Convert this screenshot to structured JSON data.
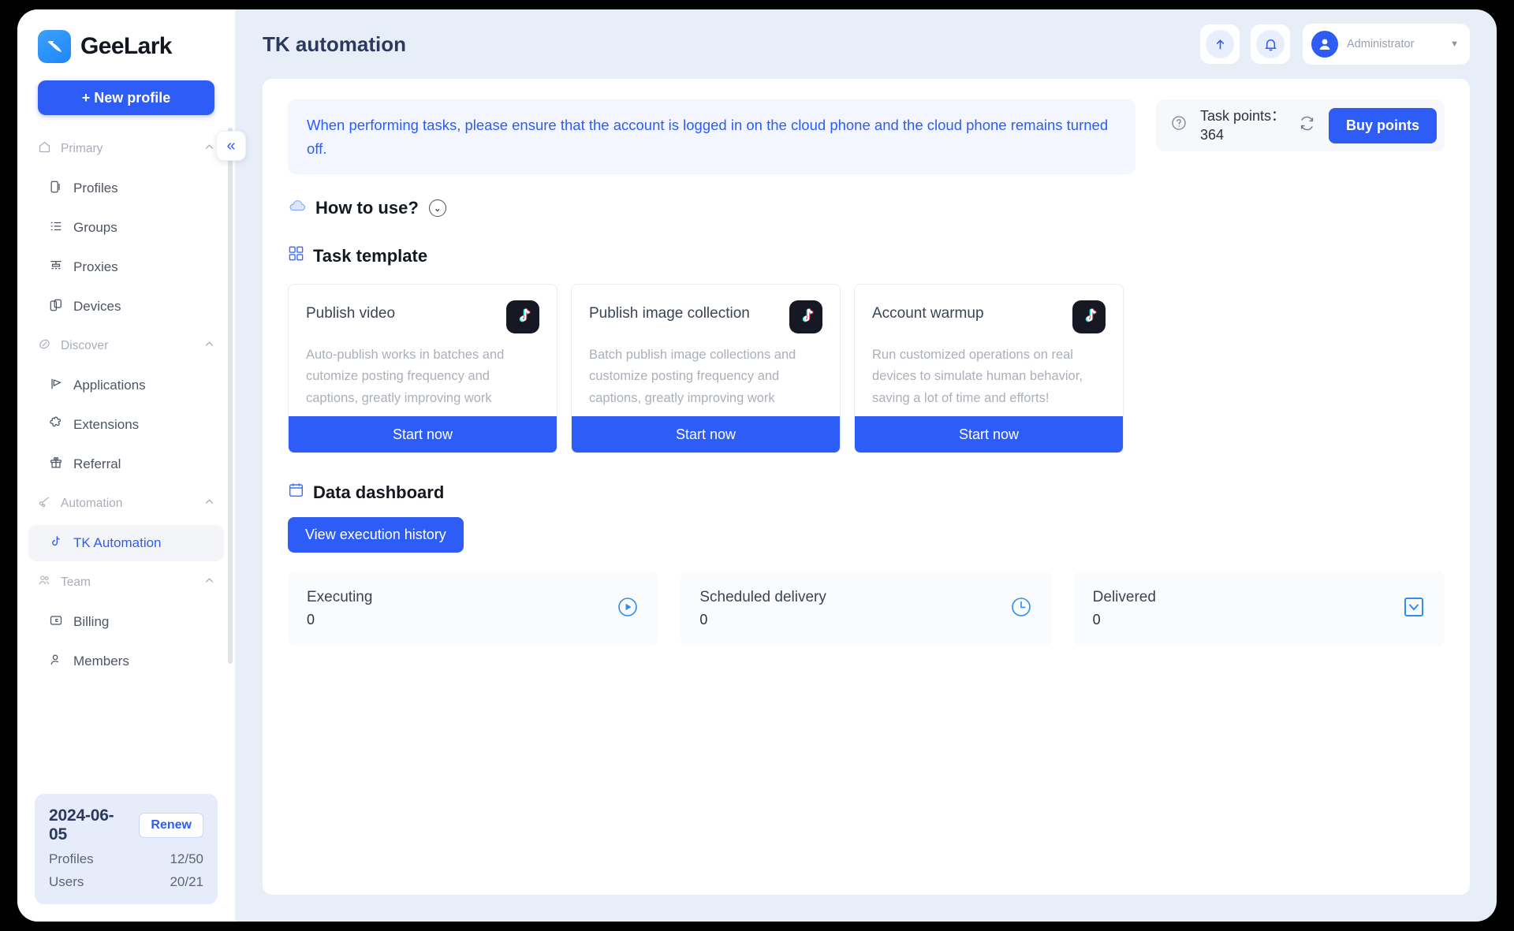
{
  "sidebar": {
    "brand": {
      "name": "GeeLark",
      "logo_icon": "geelark-bird-logo"
    },
    "new_profile_label": "+ New profile",
    "collapse_label": "«",
    "groups": [
      {
        "label": "Primary",
        "icon": "home-icon",
        "items": [
          {
            "label": "Profiles",
            "icon": "profiles-icon"
          },
          {
            "label": "Groups",
            "icon": "groups-list-icon"
          },
          {
            "label": "Proxies",
            "icon": "proxies-network-icon"
          },
          {
            "label": "Devices",
            "icon": "devices-icon"
          }
        ]
      },
      {
        "label": "Discover",
        "icon": "compass-icon",
        "items": [
          {
            "label": "Applications",
            "icon": "applications-icon"
          },
          {
            "label": "Extensions",
            "icon": "extensions-puzzle-icon"
          },
          {
            "label": "Referral",
            "icon": "gift-icon"
          }
        ]
      },
      {
        "label": "Automation",
        "icon": "automation-icon",
        "items": [
          {
            "label": "TK Automation",
            "icon": "tiktok-note-icon",
            "active": true
          }
        ]
      },
      {
        "label": "Team",
        "icon": "team-icon",
        "items": [
          {
            "label": "Billing",
            "icon": "billing-card-icon"
          },
          {
            "label": "Members",
            "icon": "member-icon"
          }
        ]
      }
    ],
    "plan": {
      "date": "2024-06-05",
      "renew_label": "Renew",
      "rows": [
        {
          "label": "Profiles",
          "value": "12/50"
        },
        {
          "label": "Users",
          "value": "20/21"
        }
      ]
    }
  },
  "header": {
    "title": "TK automation",
    "upload_icon": "upload-arrow-icon",
    "bell_icon": "bell-icon",
    "avatar_icon": "user-avatar-icon",
    "user_role": "Administrator",
    "caret_icon": "chevron-down-icon"
  },
  "notice": {
    "text": "When performing tasks, please ensure that the account is logged in on the cloud phone and the cloud phone remains turned off."
  },
  "points": {
    "help_icon": "question-circle-icon",
    "label": "Task points：",
    "value": "364",
    "refresh_icon": "refresh-icon",
    "buy_label": "Buy points"
  },
  "howto": {
    "icon": "cloud-icon",
    "label": "How to use?",
    "chevron": "⌄"
  },
  "task_template": {
    "icon": "grid-icon",
    "label": "Task template",
    "cards": [
      {
        "title": "Publish video",
        "desc": "Auto-publish works in batches and cutomize posting frequency and captions, greatly improving work",
        "logo_icon": "tiktok-logo-icon",
        "button": "Start now"
      },
      {
        "title": "Publish image collection",
        "desc": "Batch publish image collections and customize posting frequency and captions, greatly improving work",
        "logo_icon": "tiktok-logo-icon",
        "button": "Start now"
      },
      {
        "title": "Account warmup",
        "desc": "Run customized operations on real devices to simulate human behavior, saving a lot of time and efforts!",
        "logo_icon": "tiktok-logo-icon",
        "button": "Start now"
      }
    ]
  },
  "dashboard": {
    "icon": "calendar-icon",
    "label": "Data dashboard",
    "history_button": "View execution history",
    "stats": [
      {
        "label": "Executing",
        "value": "0",
        "icon": "play-circle-icon"
      },
      {
        "label": "Scheduled delivery",
        "value": "0",
        "icon": "clock-icon"
      },
      {
        "label": "Delivered",
        "value": "0",
        "icon": "chevron-down-box-icon"
      }
    ]
  },
  "colors": {
    "accent": "#2d5cf6",
    "page_bg": "#e8eef8",
    "notice_bg": "#f3f6ff",
    "title": "#2b3a5c",
    "icon_blue": "#2b8ef0"
  }
}
